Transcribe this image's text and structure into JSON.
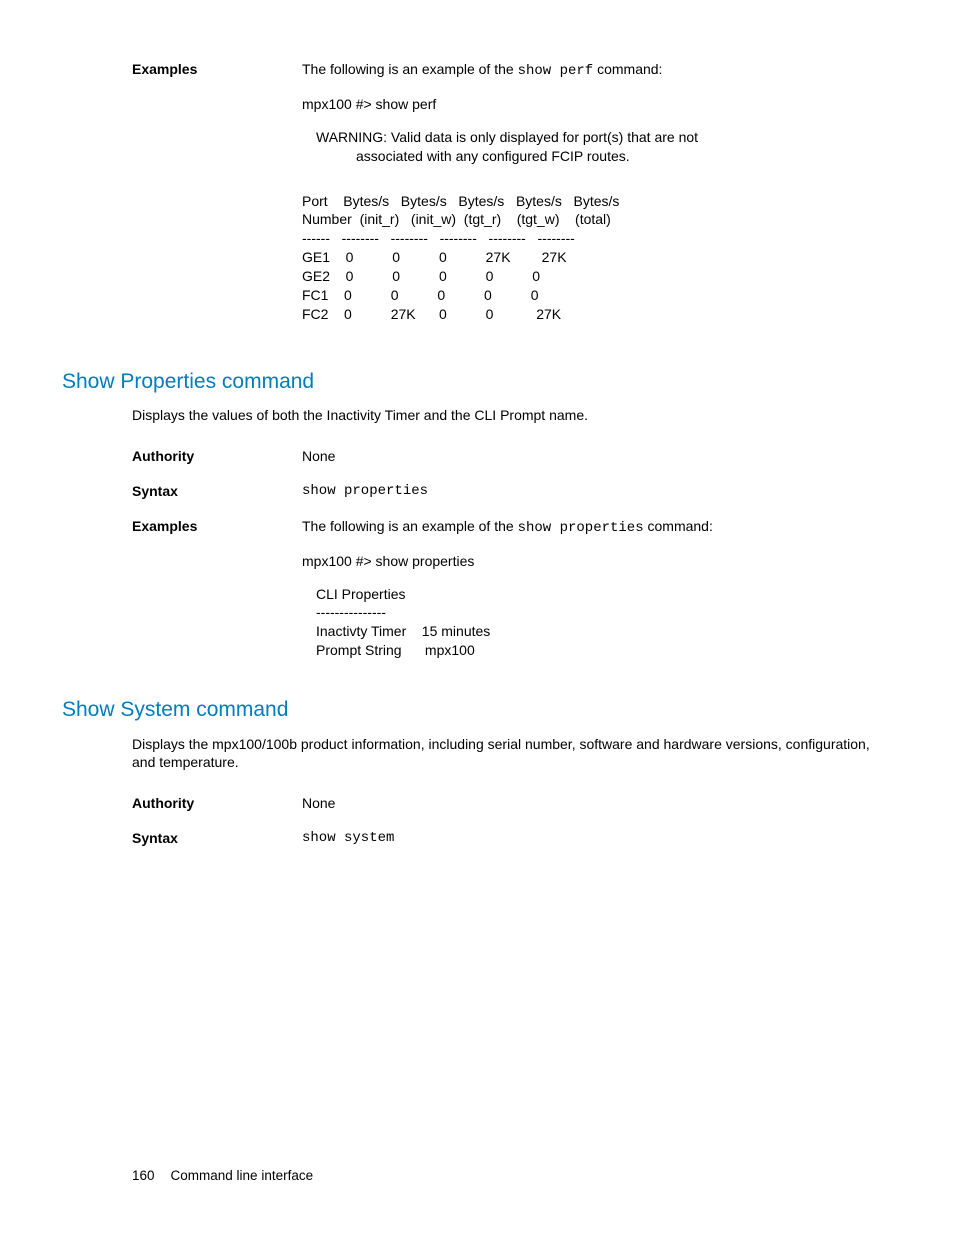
{
  "perf": {
    "label": "Examples",
    "intro_prefix": "The following is an example of the ",
    "intro_cmd": "show perf",
    "intro_suffix": " command:",
    "prompt": "mpx100 #> show perf",
    "warning_l1": "WARNING: Valid data is only displayed for port(s) that are not",
    "warning_l2": "associated with any configured FCIP routes.",
    "hdr1": "Port    Bytes/s   Bytes/s   Bytes/s   Bytes/s   Bytes/s",
    "hdr2": "Number  (init_r)   (init_w)  (tgt_r)    (tgt_w)    (total)",
    "sep": "------   --------   --------   --------   --------   --------",
    "r1": "GE1    0          0          0          27K        27K",
    "r2": "GE2    0          0          0          0          0",
    "r3": "FC1    0          0          0          0          0",
    "r4": "FC2    0          27K      0          0           27K"
  },
  "props": {
    "heading": "Show Properties command",
    "desc": "Displays the values of both the Inactivity Timer and the CLI Prompt name.",
    "authority_label": "Authority",
    "authority_value": "None",
    "syntax_label": "Syntax",
    "syntax_value": "show properties",
    "examples_label": "Examples",
    "ex_prefix": "The following is an example of the ",
    "ex_cmd": "show properties",
    "ex_suffix": " command:",
    "ex_prompt": "mpx100 #> show properties",
    "cli_label": "CLI Properties",
    "cli_sep": "---------------",
    "cli_l1": "Inactivty Timer    15 minutes",
    "cli_l2": "Prompt String      mpx100"
  },
  "sys": {
    "heading": "Show System command",
    "desc": "Displays the mpx100/100b product information, including serial number, software and hardware versions, configuration, and temperature.",
    "authority_label": "Authority",
    "authority_value": "None",
    "syntax_label": "Syntax",
    "syntax_value": "show system"
  },
  "footer": {
    "page": "160",
    "title": "Command line interface"
  }
}
